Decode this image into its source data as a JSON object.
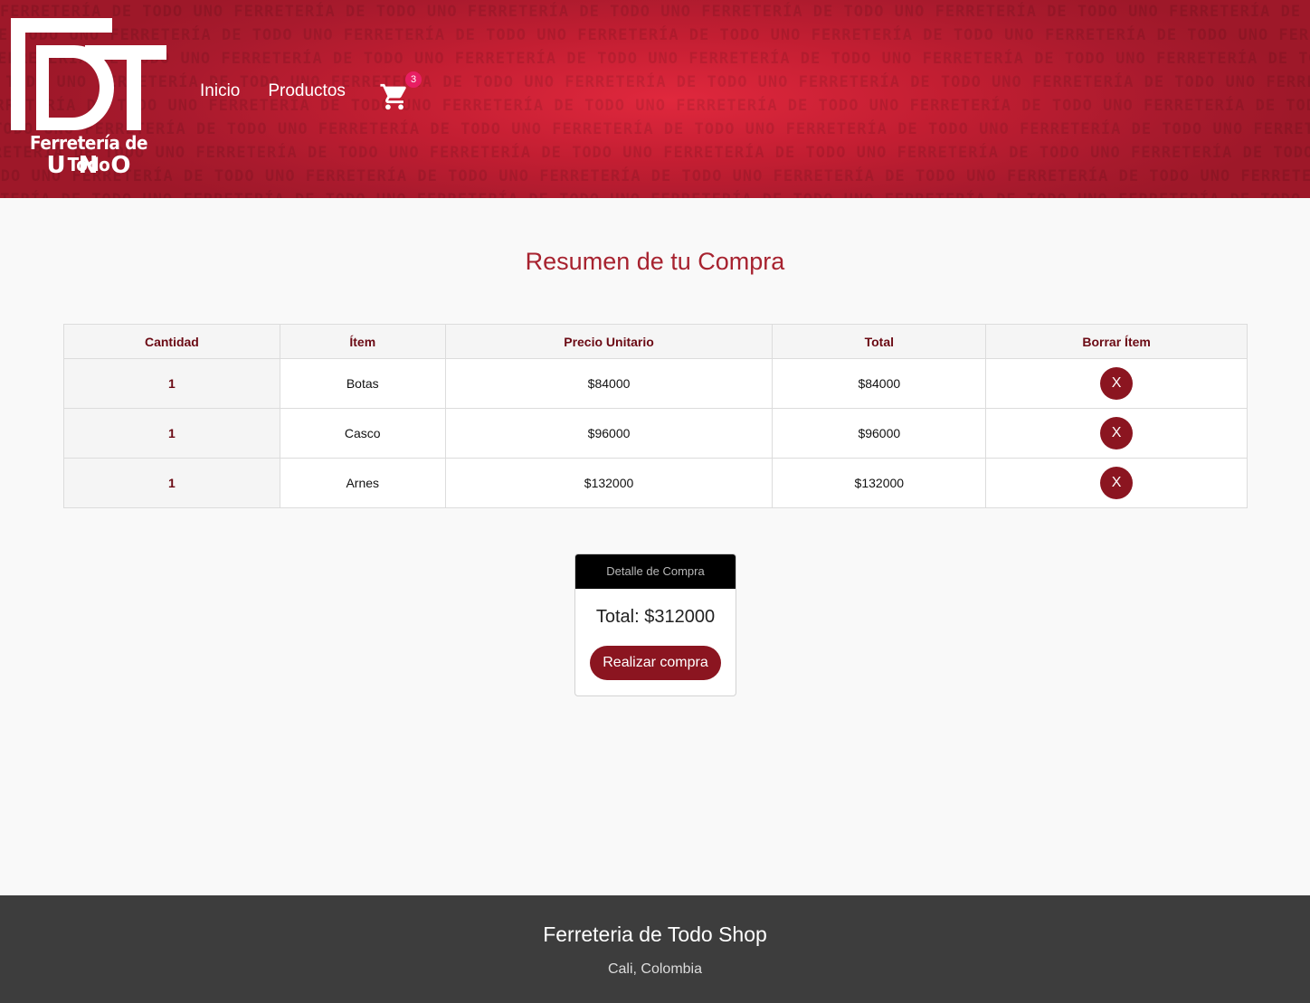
{
  "brand": {
    "logo_line1": "Ferretería de Todo",
    "logo_line2": "UNO",
    "pattern_text": "FERRETERÍA DE TODO UNO"
  },
  "nav": {
    "items": [
      {
        "label": "Inicio"
      },
      {
        "label": "Productos"
      }
    ],
    "cart_count": "3"
  },
  "page": {
    "title": "Resumen de tu Compra"
  },
  "table": {
    "headers": [
      "Cantidad",
      "Ítem",
      "Precio Unitario",
      "Total",
      "Borrar Ítem"
    ],
    "rows": [
      {
        "qty": "1",
        "item": "Botas",
        "unit_price": "$84000",
        "total": "$84000",
        "delete_label": "X"
      },
      {
        "qty": "1",
        "item": "Casco",
        "unit_price": "$96000",
        "total": "$96000",
        "delete_label": "X"
      },
      {
        "qty": "1",
        "item": "Arnes",
        "unit_price": "$132000",
        "total": "$132000",
        "delete_label": "X"
      }
    ]
  },
  "summary": {
    "header": "Detalle de Compra",
    "total_label": "Total: $312000",
    "buy_button": "Realizar compra"
  },
  "footer": {
    "title": "Ferreteria de Todo Shop",
    "location": "Cali, Colombia"
  },
  "colors": {
    "brand_red": "#c21e32",
    "accent_dark_red": "#8b1520",
    "title_red": "#a7222f",
    "badge_pink": "#e81e63",
    "footer_bg": "#3d3d3d"
  }
}
